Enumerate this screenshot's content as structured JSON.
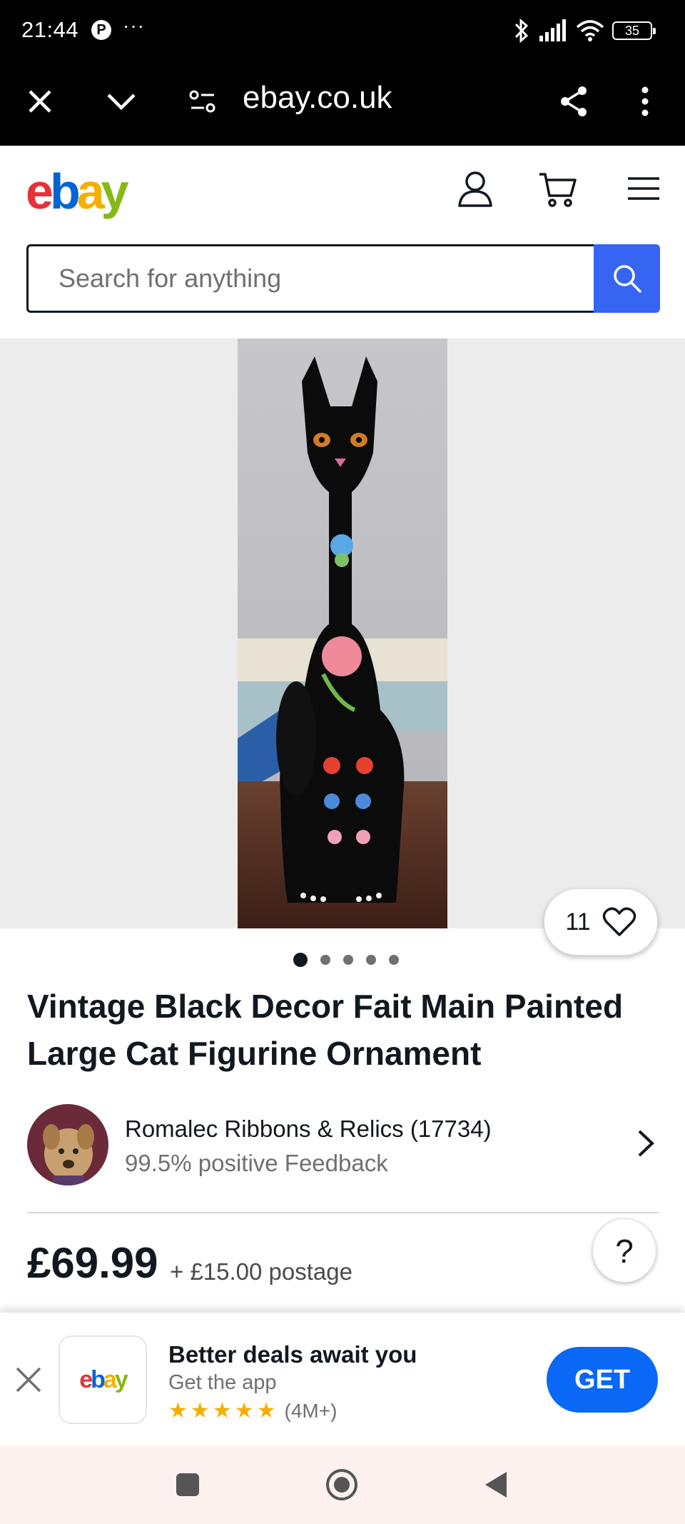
{
  "status_bar": {
    "time": "21:44",
    "pin_glyph": "P",
    "more": "···",
    "battery": "35"
  },
  "browser": {
    "url": "ebay.co.uk"
  },
  "header": {
    "logo_letters": [
      "e",
      "b",
      "a",
      "y"
    ],
    "search_placeholder": "Search for anything"
  },
  "gallery": {
    "watch_count": "11",
    "image_count": 5,
    "active_index": 0
  },
  "item": {
    "title": "Vintage Black Decor Fait Main Painted Large Cat Figurine Ornament",
    "price": "£69.99",
    "postage": "+ £15.00 postage"
  },
  "seller": {
    "name": "Romalec Ribbons & Relics (17734)",
    "feedback": "99.5% positive Feedback"
  },
  "help": {
    "label": "?"
  },
  "app_banner": {
    "title": "Better deals await you",
    "subtitle": "Get the app",
    "stars": 5,
    "downloads": "(4M+)",
    "get_label": "GET"
  },
  "colors": {
    "ebay_red": "#e53238",
    "ebay_blue": "#0064d2",
    "ebay_yellow": "#f5af02",
    "ebay_green": "#86b817",
    "search_button": "#3665f3",
    "get_button": "#0968f6"
  }
}
